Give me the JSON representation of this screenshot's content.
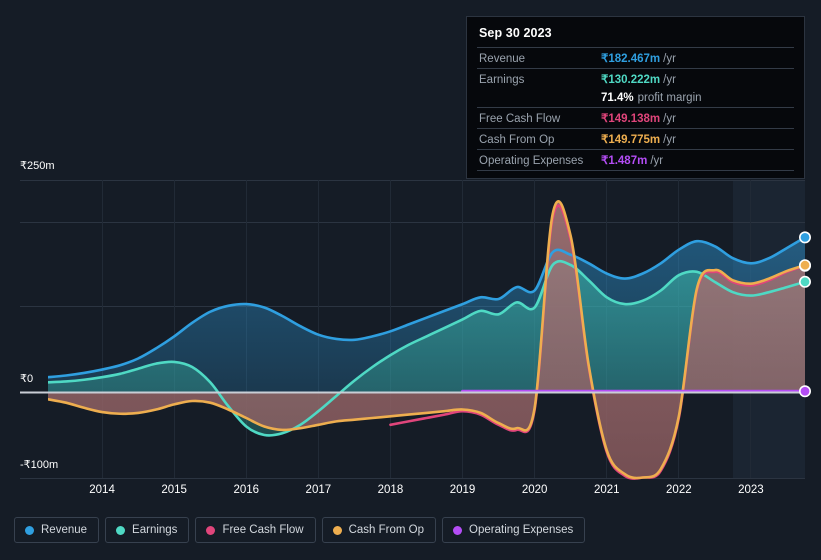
{
  "background_color": "#151c26",
  "tooltip": {
    "date": "Sep 30 2023",
    "rows": [
      {
        "label": "Revenue",
        "value": "₹182.467m",
        "unit": "/yr",
        "color": "#2f9fe0"
      },
      {
        "label": "Earnings",
        "value": "₹130.222m",
        "unit": "/yr",
        "color": "#4fd9c4"
      },
      {
        "label": "Free Cash Flow",
        "value": "₹149.138m",
        "unit": "/yr",
        "color": "#e0457b"
      },
      {
        "label": "Cash From Op",
        "value": "₹149.775m",
        "unit": "/yr",
        "color": "#eeae4f"
      },
      {
        "label": "Operating Expenses",
        "value": "₹1.487m",
        "unit": "/yr",
        "color": "#b44df5"
      }
    ],
    "profit_margin_value": "71.4%",
    "profit_margin_label": "profit margin"
  },
  "legend": {
    "items": [
      {
        "label": "Revenue",
        "color": "#2f9fe0",
        "icon": "legend-dot-icon"
      },
      {
        "label": "Earnings",
        "color": "#4fd9c4",
        "icon": "legend-dot-icon"
      },
      {
        "label": "Free Cash Flow",
        "color": "#e0457b",
        "icon": "legend-dot-icon"
      },
      {
        "label": "Cash From Op",
        "color": "#eeae4f",
        "icon": "legend-dot-icon"
      },
      {
        "label": "Operating Expenses",
        "color": "#b44df5",
        "icon": "legend-dot-icon"
      }
    ]
  },
  "axis": {
    "y_top_label": "₹250m",
    "y_zero_label": "₹0",
    "y_bottom_label": "-₹100m"
  },
  "chart_data": {
    "type": "area",
    "title": "",
    "xlabel": "",
    "ylabel": "",
    "currency": "INR",
    "unit": "millions per year",
    "ylim": [
      -100,
      250
    ],
    "y_ticks": [
      -100,
      0,
      100,
      200,
      250
    ],
    "y_tick_labels": [
      "-₹100m",
      "₹0",
      "",
      "",
      "₹250m"
    ],
    "grid": true,
    "legend_position": "bottom",
    "x_ticks": [
      2014,
      2015,
      2016,
      2017,
      2018,
      2019,
      2020,
      2021,
      2022,
      2023
    ],
    "x_tick_labels": [
      "2014",
      "2015",
      "2016",
      "2017",
      "2018",
      "2019",
      "2020",
      "2021",
      "2022",
      "2023"
    ],
    "xlim": [
      2013.25,
      2023.75
    ],
    "forecast_start_x": 2022.5,
    "x": [
      2013.25,
      2013.5,
      2013.75,
      2014.0,
      2014.25,
      2014.5,
      2014.75,
      2015.0,
      2015.25,
      2015.5,
      2015.75,
      2016.0,
      2016.25,
      2016.5,
      2016.75,
      2017.0,
      2017.25,
      2017.5,
      2017.75,
      2018.0,
      2018.25,
      2018.5,
      2018.75,
      2019.0,
      2019.25,
      2019.5,
      2019.75,
      2020.0,
      2020.25,
      2020.5,
      2020.75,
      2021.0,
      2021.25,
      2021.5,
      2021.75,
      2022.0,
      2022.25,
      2022.5,
      2022.75,
      2023.0,
      2023.25,
      2023.5,
      2023.75
    ],
    "series": [
      {
        "name": "Revenue",
        "color": "#2f9fe0",
        "values": [
          18,
          20,
          23,
          27,
          32,
          40,
          52,
          66,
          82,
          95,
          102,
          104,
          100,
          90,
          78,
          68,
          63,
          62,
          66,
          72,
          80,
          88,
          96,
          104,
          112,
          110,
          124,
          120,
          165,
          162,
          152,
          140,
          134,
          140,
          152,
          168,
          178,
          172,
          158,
          152,
          158,
          170,
          182.467
        ],
        "final_value": 182.467
      },
      {
        "name": "Earnings",
        "color": "#4fd9c4",
        "values": [
          12,
          13,
          15,
          18,
          22,
          28,
          34,
          36,
          30,
          12,
          -16,
          -40,
          -50,
          -48,
          -38,
          -22,
          -4,
          14,
          30,
          44,
          56,
          66,
          76,
          86,
          96,
          92,
          106,
          100,
          150,
          150,
          132,
          112,
          104,
          108,
          120,
          138,
          142,
          130,
          118,
          114,
          118,
          124,
          130.222
        ],
        "final_value": 130.222
      },
      {
        "name": "Free Cash Flow",
        "color": "#e0457b",
        "values": [
          null,
          null,
          null,
          null,
          null,
          null,
          null,
          null,
          null,
          null,
          null,
          null,
          null,
          null,
          null,
          null,
          null,
          null,
          null,
          -38,
          -34,
          -30,
          -26,
          -22,
          -26,
          -38,
          -44,
          -20,
          205,
          180,
          30,
          -70,
          -98,
          -100,
          -92,
          -30,
          120,
          142,
          130,
          126,
          132,
          142,
          149.138
        ],
        "final_value": 149.138
      },
      {
        "name": "Cash From Op",
        "color": "#eeae4f",
        "values": [
          -8,
          -12,
          -18,
          -23,
          -25,
          -24,
          -20,
          -14,
          -10,
          -12,
          -20,
          -30,
          -40,
          -44,
          -42,
          -38,
          -34,
          -32,
          -30,
          -28,
          -26,
          -24,
          -22,
          -20,
          -24,
          -36,
          -42,
          -18,
          210,
          184,
          32,
          -68,
          -96,
          -100,
          -90,
          -28,
          122,
          144,
          132,
          128,
          134,
          143,
          149.775
        ],
        "final_value": 149.775
      },
      {
        "name": "Operating Expenses",
        "color": "#b44df5",
        "values": [
          null,
          null,
          null,
          null,
          null,
          null,
          null,
          null,
          null,
          null,
          null,
          null,
          null,
          null,
          null,
          null,
          null,
          null,
          null,
          null,
          null,
          null,
          null,
          1.5,
          1.5,
          1.5,
          1.5,
          1.5,
          1.5,
          1.5,
          1.5,
          1.5,
          1.5,
          1.5,
          1.5,
          1.5,
          1.5,
          1.5,
          1.5,
          1.5,
          1.5,
          1.5,
          1.487
        ],
        "final_value": 1.487
      }
    ]
  }
}
